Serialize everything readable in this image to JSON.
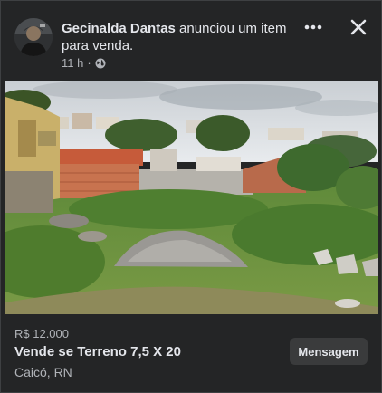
{
  "post": {
    "author_name": "Gecinalda Dantas",
    "action_text": " anunciou um item para venda.",
    "time": "11 h",
    "separator": "·",
    "privacy_icon": "globe-icon"
  },
  "header_actions": {
    "more_icon": "more-horizontal-icon",
    "close_icon": "close-icon"
  },
  "listing": {
    "price": "R$ 12.000",
    "title": "Vende se Terreno 7,5 X 20",
    "location": "Caicó, RN",
    "message_button": "Mensagem"
  },
  "colors": {
    "card_background": "#242526",
    "primary_text": "#e4e6eb",
    "secondary_text": "#b0b3b8",
    "button_background": "#3a3b3c"
  }
}
